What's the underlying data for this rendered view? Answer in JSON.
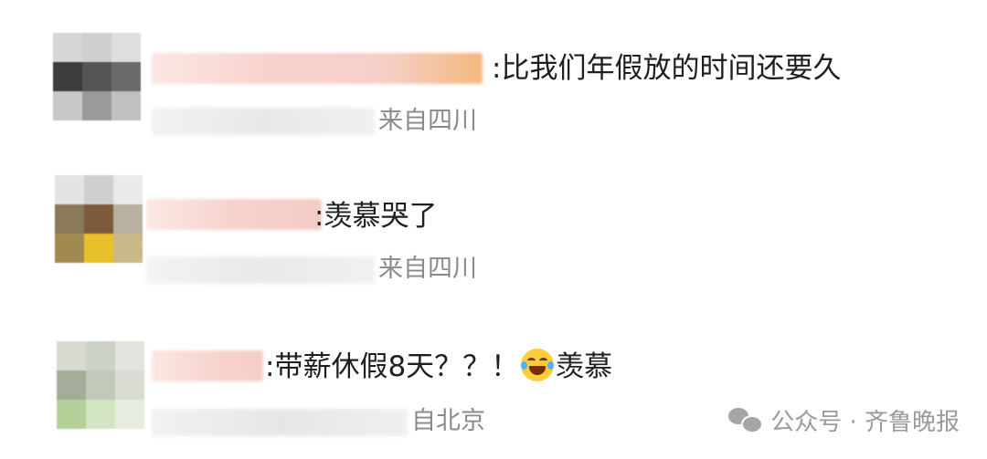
{
  "comments": [
    {
      "text": ":比我们年假放的时间还要久",
      "location": "来自四川"
    },
    {
      "text": ":羡慕哭了",
      "location": "来自四川"
    },
    {
      "text_before_emoji": ":带薪休假8天？？！",
      "emoji": "laughing-crying-emoji",
      "text_after_emoji": "羡慕",
      "location": "自北京"
    }
  ],
  "watermark": {
    "label": "公众号 · 齐鲁晚报",
    "icon": "wechat-icon"
  }
}
